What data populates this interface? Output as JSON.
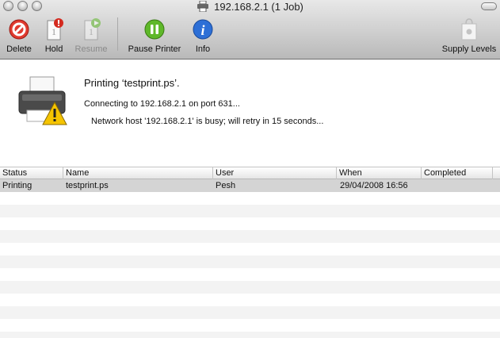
{
  "window": {
    "title": "192.168.2.1 (1 Job)"
  },
  "toolbar": {
    "delete_label": "Delete",
    "hold_label": "Hold",
    "resume_label": "Resume",
    "pause_label": "Pause Printer",
    "info_label": "Info",
    "supply_label": "Supply Levels"
  },
  "status": {
    "job_line": "Printing ‘testprint.ps’.",
    "connection_line": "Connecting to 192.168.2.1 on port 631...",
    "network_line": "Network host '192.168.2.1' is busy; will retry in 15 seconds..."
  },
  "table": {
    "columns": [
      "Status",
      "Name",
      "User",
      "When",
      "Completed"
    ],
    "rows": [
      {
        "status": "Printing",
        "name": "testprint.ps",
        "user": "Pesh",
        "when": "29/04/2008 16:56",
        "completed": ""
      }
    ]
  },
  "colors": {
    "delete_red": "#e03a2f",
    "pause_green": "#5fb82a",
    "info_blue": "#2d6fd6",
    "warning_yellow": "#f5c400",
    "selected_row": "#d4d4d4",
    "alt_row": "#f3f3f3"
  }
}
